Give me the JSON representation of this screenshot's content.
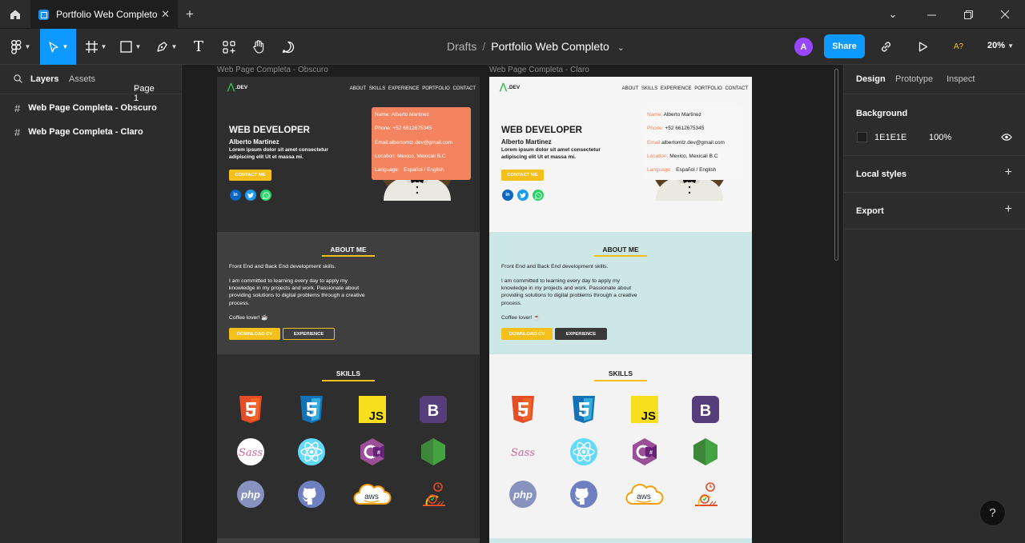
{
  "window": {
    "tab_title": "Portfolio Web Completo",
    "tab_close": "✕",
    "new_tab": "+"
  },
  "toolbar": {
    "breadcrumb_root": "Drafts",
    "breadcrumb_sep": "/",
    "file_name": "Portfolio Web Completo",
    "file_caret": "⌄",
    "avatar_initial": "A",
    "share_label": "Share",
    "font_check": "A?",
    "zoom": "20%",
    "text_tool": "T"
  },
  "left_panel": {
    "tabs": {
      "layers": "Layers",
      "assets": "Assets",
      "page": "Page 1"
    },
    "layers": [
      {
        "name": "Web Page Completa - Obscuro"
      },
      {
        "name": "Web Page Completa - Claro"
      }
    ]
  },
  "frames": [
    {
      "label": "Web Page Completa - Obscuro",
      "theme": "dark",
      "colors": {
        "hero": "#2e2e2e",
        "about": "#3f3f3f",
        "skills": "#2e2e2e",
        "text": "#ffffff",
        "infobox": "#f4845f",
        "infokey": "#ffffff",
        "infoval": "#ffffff"
      }
    },
    {
      "label": "Web Page Completa - Claro",
      "theme": "light",
      "colors": {
        "hero": "#f5f5f5",
        "about": "#cde6e6",
        "skills": "#f3f3f3",
        "text": "#1a1a1a",
        "infobox": "#f7f7f7",
        "infokey": "#f4845f",
        "infoval": "#1a1a1a"
      }
    }
  ],
  "site": {
    "logo": ".DEV",
    "nav_links": "ABOUT  SKILLS  EXPERIENCE  PORTFOLIO  CONTACT",
    "hero_title": "WEB DEVELOPER",
    "hero_name": "Alberto Martinez",
    "hero_desc": "Lorem ipsum dolor sit amet consectetur adipiscing elit Ut et massa mi.",
    "contact_btn": "CONTACT ME",
    "about_title": "ABOUT ME",
    "about_p1": "Front End and Back End development skills.",
    "about_p2": "I am committed to learning every day to apply my knowledge in my projects and work. Passionate about providing solutions to digital problems through a creative process.",
    "about_p3": "Coffee lover! ☕",
    "info": {
      "name_k": "Name:",
      "name_v": "Alberto Martinez",
      "phone_k": "Phone:",
      "phone_v": "+52 6612675345",
      "email_k": "Email:",
      "email_v": "albertomtz.dev@gmail.com",
      "location_k": "Location:",
      "location_v": "Mexico, Mexicali B.C",
      "language_k": "Language:",
      "language_v": "Español / English"
    },
    "download_btn": "DOWNLOAD CV",
    "experience_btn": "EXPERIENCE",
    "skills_title": "SKILLS",
    "skills": [
      "html5-icon",
      "css3-icon",
      "javascript-icon",
      "bootstrap-icon",
      "sass-icon",
      "react-icon",
      "csharp-icon",
      "nodejs-icon",
      "php-icon",
      "github-icon",
      "aws-icon",
      "performance-icon"
    ]
  },
  "right_panel": {
    "tabs": {
      "design": "Design",
      "prototype": "Prototype",
      "inspect": "Inspect"
    },
    "background_label": "Background",
    "bg_hex": "1E1E1E",
    "bg_opacity": "100%",
    "local_styles": "Local styles",
    "export": "Export",
    "plus": "+"
  },
  "help": "?"
}
